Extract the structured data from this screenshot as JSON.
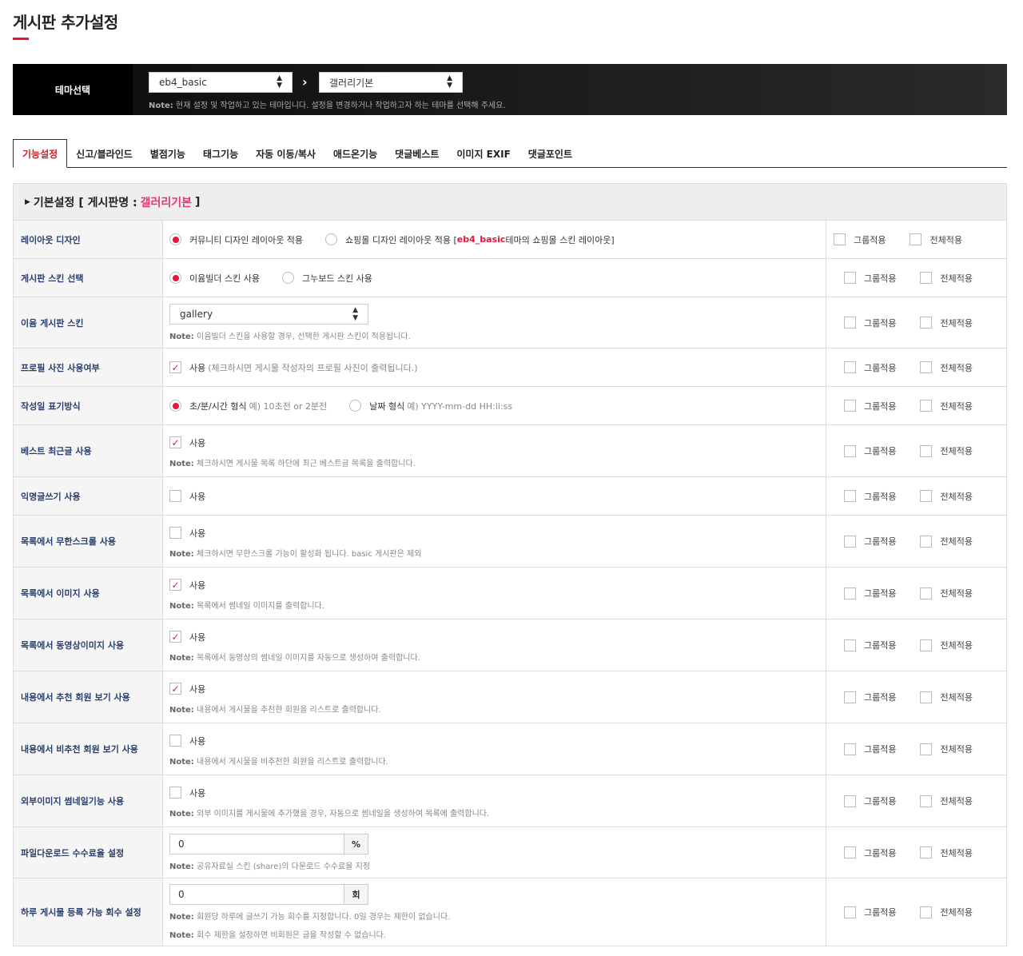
{
  "page_title": "게시판 추가설정",
  "theme": {
    "label": "테마선택",
    "theme_select": "eb4_basic",
    "board_select": "갤러리기본",
    "note_prefix": "Note:",
    "note": "현재 설정 및 작업하고 있는 테마입니다. 설정을 변경하거나 작업하고자 하는 테마를 선택해 주세요."
  },
  "tabs": [
    "기능설정",
    "신고/블라인드",
    "별점기능",
    "태그기능",
    "자동 이동/복사",
    "애드온기능",
    "댓글베스트",
    "이미지 EXIF",
    "댓글포인트"
  ],
  "panel": {
    "title_prefix": "기본설정 [ 게시판명 :",
    "board_name": "갤러리기본",
    "title_suffix": "]"
  },
  "apply": {
    "group": "그룹적용",
    "all": "전체적용"
  },
  "note_label": "Note:",
  "use_label": "사용",
  "rows": {
    "layout": {
      "label": "레이아웃 디자인",
      "opt1": "커뮤니티 디자인 레이아웃 적용",
      "opt2_a": "쇼핑몰 디자인 레이아웃 적용 [",
      "opt2_b": "eb4_basic",
      "opt2_c": " 테마의 쇼핑몰 스킨 레이아웃]"
    },
    "skin_select": {
      "label": "게시판 스킨 선택",
      "opt1": "이윰빌더 스킨 사용",
      "opt2": "그누보드 스킨 사용"
    },
    "eyoom_skin": {
      "label": "이윰 게시판 스킨",
      "value": "gallery",
      "note": "이윰빌더 스킨을 사용할 경우, 선택한 게시판 스킨이 적용됩니다."
    },
    "profile": {
      "label": "프로필 사진 사용여부",
      "hint": "(체크하시면 게시물 작성자의 프로필 사진이 출력됩니다.)"
    },
    "date": {
      "label": "작성일 표기방식",
      "opt1": "초/분/시간 형식",
      "opt1_hint": "예) 10초전 or 2분전",
      "opt2": "날짜 형식",
      "opt2_hint": "예) YYYY-mm-dd HH:ii:ss"
    },
    "best": {
      "label": "베스트 최근글 사용",
      "note": "체크하시면 게시물 목록 하단에 최근 베스트글 목록을 출력합니다."
    },
    "anon": {
      "label": "익명글쓰기 사용"
    },
    "infinite": {
      "label": "목록에서 무한스크롤 사용",
      "note": "체크하시면 무한스크롤 기능이 활성화 됩니다. basic 게시판은 제외"
    },
    "list_image": {
      "label": "목록에서 이미지 사용",
      "note": "목록에서 썸네일 이미지를 출력합니다."
    },
    "list_video": {
      "label": "목록에서 동영상이미지 사용",
      "note": "목록에서 동영상의 썸네일 이미지를 자동으로 생성하여 출력합니다."
    },
    "rec_view": {
      "label": "내용에서 추천 회원 보기 사용",
      "note": "내용에서 게시물을 추천한 회원을 리스트로 출력합니다."
    },
    "nonrec_view": {
      "label": "내용에서 비추천 회원 보기 사용",
      "note": "내용에서 게시물을 비추천한 회원을 리스트로 출력합니다."
    },
    "ext_thumb": {
      "label": "외부이미지 썸네일기능 사용",
      "note": "외부 이미지를 게시물에 추가했을 경우, 자동으로 썸네일을 생성하여 목록에 출력합니다."
    },
    "download_fee": {
      "label": "파일다운로드 수수료율 설정",
      "value": "0",
      "unit": "%",
      "note": "공유자료실 스킨 (share)의 다운로드 수수료율 지정"
    },
    "daily_limit": {
      "label": "하루 게시물 등록 가능 회수 설정",
      "value": "0",
      "unit": "회",
      "note1": "회원당 하루에 글쓰기 가능 회수를 지정합니다. 0일 경우는 제한이 없습니다.",
      "note2": "회수 제한을 설정하면 비회원은 글을 작성할 수 없습니다."
    }
  },
  "state": {
    "layout_selected": "opt1",
    "skin_selected": "opt1",
    "date_selected": "opt1",
    "profile_checked": true,
    "best_checked": true,
    "anon_checked": false,
    "infinite_checked": false,
    "list_image_checked": true,
    "list_video_checked": true,
    "rec_view_checked": true,
    "nonrec_view_checked": false,
    "ext_thumb_checked": false
  }
}
